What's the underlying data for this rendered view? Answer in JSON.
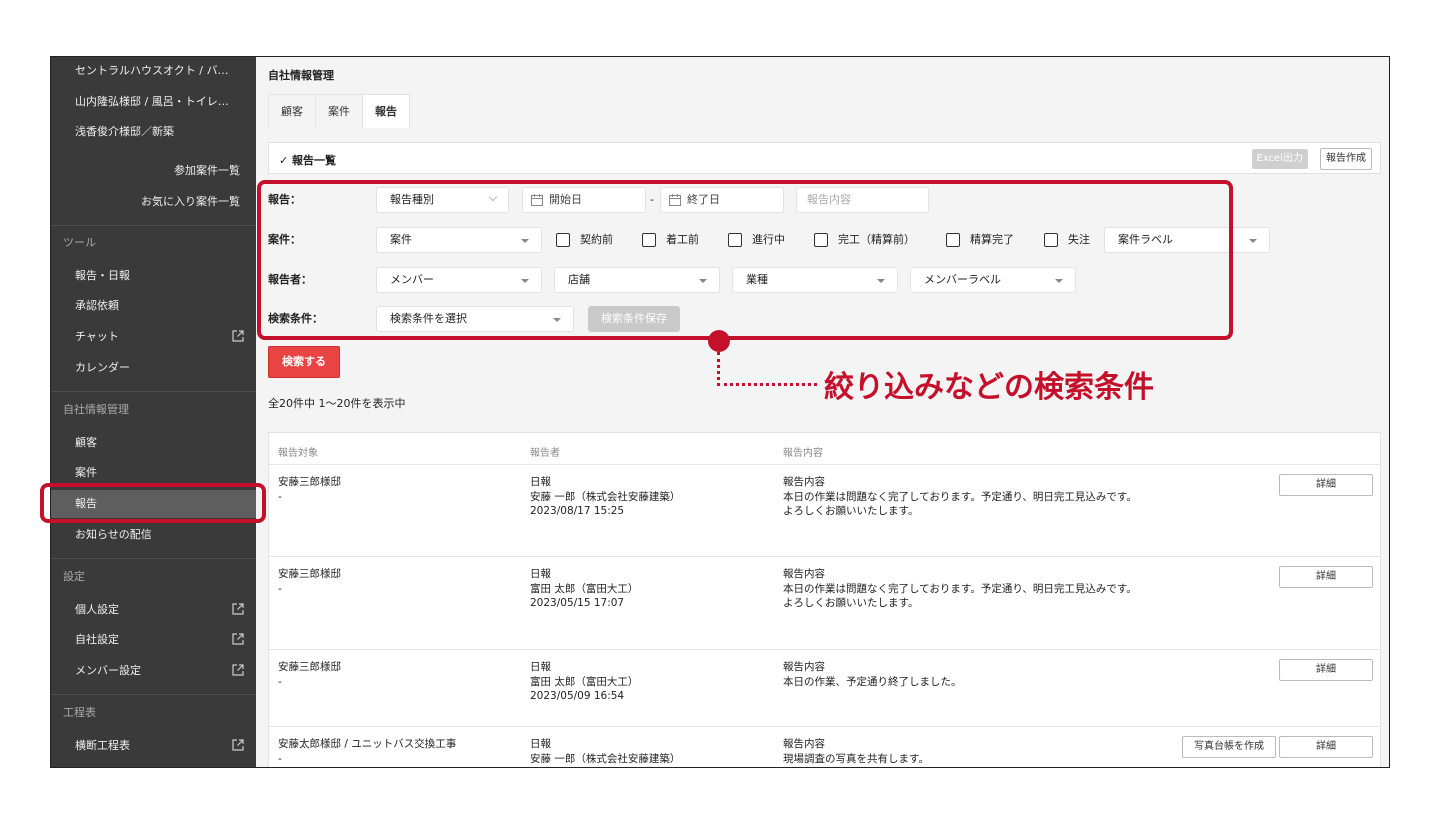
{
  "sidebar": {
    "projects": [
      "セントラルハウスオクト / バ…",
      "山内隆弘様邸 / 風呂・トイレ…",
      "浅香俊介様邸／新築"
    ],
    "links": [
      "参加案件一覧",
      "お気に入り案件一覧"
    ],
    "tools_section": "ツール",
    "tools": [
      "報告・日報",
      "承認依頼",
      "チャット",
      "カレンダー"
    ],
    "company_section": "自社情報管理",
    "company": [
      "顧客",
      "案件",
      "報告",
      "お知らせの配信"
    ],
    "settings_section": "設定",
    "settings": [
      "個人設定",
      "自社設定",
      "メンバー設定"
    ],
    "schedule_section": "工程表",
    "schedule": [
      "横断工程表"
    ]
  },
  "page": {
    "title": "自社情報管理",
    "tabs": [
      "顧客",
      "案件",
      "報告"
    ],
    "active_tab": "報告",
    "list_title": "✓ 報告一覧",
    "excel_button": "Excel出力",
    "create_button": "報告作成"
  },
  "filters": {
    "report_label": "報告：",
    "report_type": "報告種別",
    "start_date": "開始日",
    "dash": "-",
    "end_date": "終了日",
    "report_content_placeholder": "報告内容",
    "project_label": "案件：",
    "project_select": "案件",
    "checks": [
      "契約前",
      "着工前",
      "進行中",
      "完工（精算前）",
      "精算完了",
      "失注"
    ],
    "project_label_select": "案件ラベル",
    "reporter_label": "報告者：",
    "member": "メンバー",
    "store": "店舗",
    "industry": "業種",
    "member_label": "メンバーラベル",
    "condition_label": "検索条件：",
    "condition_select": "検索条件を選択",
    "save_button": "検索条件保存",
    "search_button": "検索する"
  },
  "result_count": "全20件中 1〜20件を表示中",
  "table": {
    "headers": [
      "報告対象",
      "報告者",
      "報告内容"
    ],
    "rows": [
      {
        "target": "安藤三郎様邸",
        "target_sub": "-",
        "type": "日報",
        "reporter": "安藤 一郎（株式会社安藤建築）",
        "date": "2023/08/17 15:25",
        "content_label": "報告内容",
        "content1": "本日の作業は問題なく完了しております。予定通り、明日完工見込みです。",
        "content2": "よろしくお願いいたします。",
        "detail": "詳細"
      },
      {
        "target": "安藤三郎様邸",
        "target_sub": "-",
        "type": "日報",
        "reporter": "富田 太郎（富田大工）",
        "date": "2023/05/15 17:07",
        "content_label": "報告内容",
        "content1": "本日の作業は問題なく完了しております。予定通り、明日完工見込みです。",
        "content2": "よろしくお願いいたします。",
        "detail": "詳細"
      },
      {
        "target": "安藤三郎様邸",
        "target_sub": "-",
        "type": "日報",
        "reporter": "富田 太郎（富田大工）",
        "date": "2023/05/09 16:54",
        "content_label": "報告内容",
        "content1": "本日の作業、予定通り終了しました。",
        "content2": "",
        "detail": "詳細"
      },
      {
        "target": "安藤太郎様邸 / ユニットバス交換工事",
        "target_sub": "-",
        "type": "日報",
        "reporter": "安藤 一郎（株式会社安藤建築）",
        "date": "",
        "content_label": "報告内容",
        "content1": "現場調査の写真を共有します。",
        "content2": "",
        "detail": "詳細",
        "photo_button": "写真台帳を作成"
      }
    ]
  },
  "annotation": {
    "text": "絞り込みなどの検索条件",
    "color": "#c4102a"
  }
}
